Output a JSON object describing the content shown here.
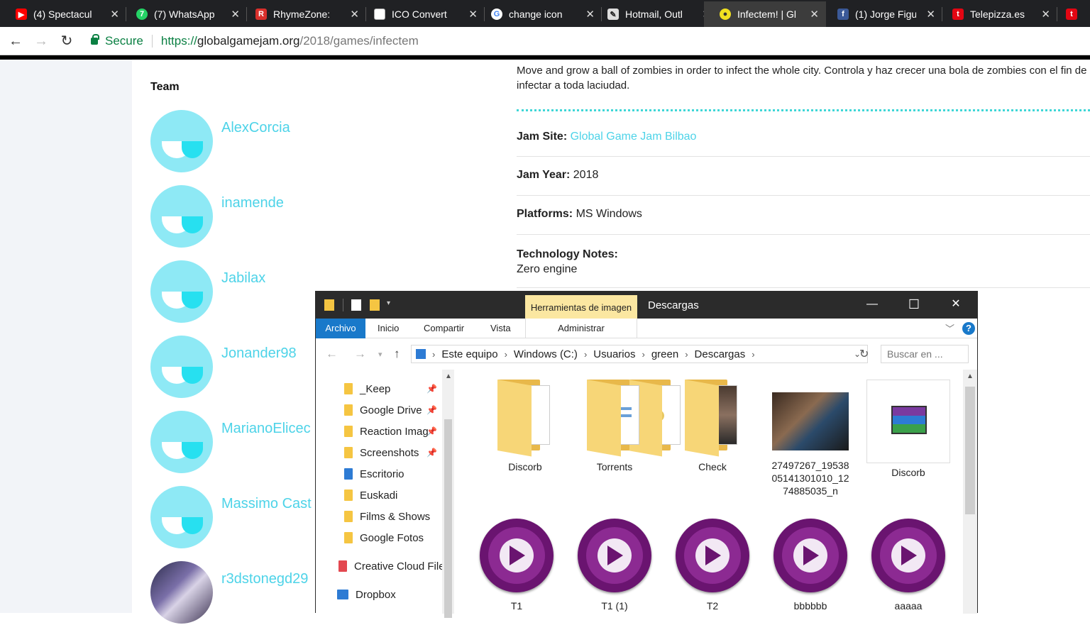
{
  "browser": {
    "tabs": [
      {
        "title": "(4) Spectacul",
        "icon": "youtube-icon",
        "color": "#ff0000"
      },
      {
        "title": "(7) WhatsApp",
        "icon": "whatsapp-icon",
        "color": "#25d366"
      },
      {
        "title": "RhymeZone:",
        "icon": "rhymezone-icon",
        "color": "#d9302c"
      },
      {
        "title": "ICO Convert",
        "icon": "page-icon",
        "color": "#ffffff"
      },
      {
        "title": "change icon",
        "icon": "google-icon",
        "color": "#ffffff"
      },
      {
        "title": "Hotmail, Outl",
        "icon": "outlook-icon",
        "color": "#dddddd"
      },
      {
        "title": "Infectem! | Gl",
        "icon": "ggj-icon",
        "color": "#f0e020"
      },
      {
        "title": "(1) Jorge Figu",
        "icon": "facebook-icon",
        "color": "#3b5998"
      },
      {
        "title": "Telepizza.es",
        "icon": "telepizza-icon",
        "color": "#e30613"
      },
      {
        "title": "",
        "icon": "telepizza-icon",
        "color": "#e30613"
      }
    ],
    "address": {
      "secure_label": "Secure",
      "https": "https://",
      "host": "globalgamejam.org",
      "path": "/2018/games/infectem"
    }
  },
  "page": {
    "team_heading": "Team",
    "members": [
      "AlexCorcia",
      "inamende",
      "Jabilax",
      "Jonander98",
      "MarianoElicec",
      "Massimo Cast",
      "r3dstonegd29"
    ],
    "description": "Move and grow a ball of zombies in order to infect the whole city. Controla y haz crecer una bola de zombies con el fin de infectar a toda laciudad.",
    "jam_site": {
      "label": "Jam Site:",
      "value": "Global Game Jam Bilbao"
    },
    "jam_year": {
      "label": "Jam Year:",
      "value": "2018"
    },
    "platforms": {
      "label": "Platforms:",
      "value": "MS Windows"
    },
    "tech": {
      "label": "Technology Notes:",
      "value": "Zero engine"
    }
  },
  "explorer": {
    "contextual_tab": "Herramientas de imagen",
    "title": "Descargas",
    "ribbon_tabs": [
      "Archivo",
      "Inicio",
      "Compartir",
      "Vista"
    ],
    "admin_tab": "Administrar",
    "breadcrumb": [
      "Este equipo",
      "Windows (C:)",
      "Usuarios",
      "green",
      "Descargas"
    ],
    "search_placeholder": "Buscar en ...",
    "nav_items": [
      {
        "label": "_Keep",
        "pinned": true
      },
      {
        "label": "Google Drive",
        "pinned": true
      },
      {
        "label": "Reaction Imag",
        "pinned": true
      },
      {
        "label": "Screenshots",
        "pinned": true
      },
      {
        "label": "Escritorio",
        "pinned": false
      },
      {
        "label": "Euskadi",
        "pinned": false
      },
      {
        "label": "Films & Shows",
        "pinned": false
      },
      {
        "label": "Google Fotos",
        "pinned": false
      },
      {
        "label": "Creative Cloud File",
        "pinned": false
      },
      {
        "label": "Dropbox",
        "pinned": false
      }
    ],
    "files_row1": [
      "Discorb",
      "Torrents",
      "Check",
      "27497267_1953805141301010_1274885035_n",
      "Discorb"
    ],
    "files_row2": [
      "T1",
      "T1 (1)",
      "T2",
      "bbbbbb",
      "aaaaa"
    ]
  }
}
